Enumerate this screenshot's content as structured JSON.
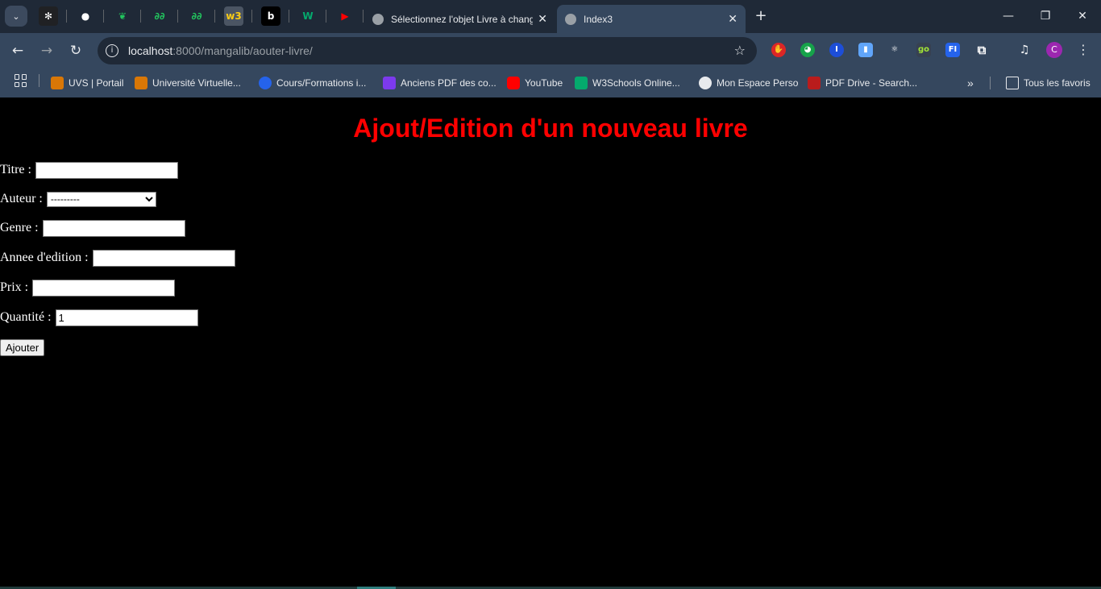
{
  "browser": {
    "tabs": [
      {
        "title": "Sélectionnez l'objet Livre à changer",
        "active": false
      },
      {
        "title": "Index3",
        "active": true
      }
    ],
    "url_host": "localhost",
    "url_path": ":8000/mangalib/aouter-livre/",
    "profile_initial": "C",
    "bookmarks": [
      {
        "label": "UVS | Portail",
        "icon": "uvs-icon",
        "color": "#d97706"
      },
      {
        "label": "Université Virtuelle...",
        "icon": "uvs-icon",
        "color": "#d97706"
      },
      {
        "label": "Cours/Formations i...",
        "icon": "course-icon",
        "color": "#2563eb"
      },
      {
        "label": "Anciens PDF des co...",
        "icon": "pdf-icon",
        "color": "#7c3aed"
      },
      {
        "label": "YouTube",
        "icon": "youtube-icon",
        "color": "#ff0000"
      },
      {
        "label": "W3Schools Online...",
        "icon": "w3schools-icon",
        "color": "#04aa6d"
      },
      {
        "label": "Mon Espace Perso",
        "icon": "globe-icon",
        "color": "#e8eaed"
      },
      {
        "label": "PDF Drive - Search...",
        "icon": "pdfdrive-icon",
        "color": "#b91c1c"
      }
    ],
    "all_bookmarks_label": "Tous les favoris"
  },
  "form": {
    "heading": "Ajout/Edition d'un nouveau livre",
    "fields": {
      "titre": {
        "label": "Titre :",
        "value": ""
      },
      "auteur": {
        "label": "Auteur :",
        "selected": "---------"
      },
      "genre": {
        "label": "Genre :",
        "value": ""
      },
      "annee": {
        "label": "Annee d'edition :",
        "value": ""
      },
      "prix": {
        "label": "Prix :",
        "value": ""
      },
      "quantite": {
        "label": "Quantité :",
        "value": "1"
      }
    },
    "submit_label": "Ajouter"
  },
  "colors": {
    "heading": "#ff0000",
    "page_bg": "#000000",
    "label": "#ffffff"
  }
}
